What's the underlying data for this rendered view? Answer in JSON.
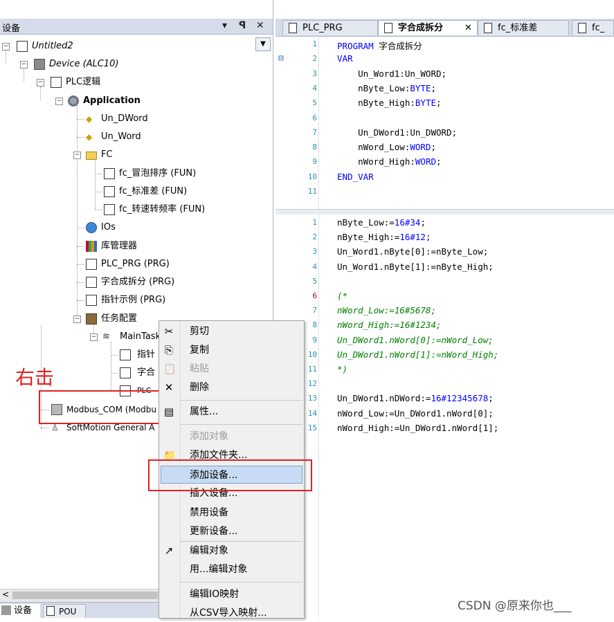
{
  "left_panel": {
    "title": "设备",
    "dropdown_btn": "▾",
    "pin_btn": "ꟼ",
    "close_btn": "✕",
    "combo_arrow": "▼",
    "tree": [
      {
        "label": "Untitled2"
      },
      {
        "label": "Device (ALC10)"
      },
      {
        "label": "PLC逻辑"
      },
      {
        "label": "Application"
      },
      {
        "label": "Un_DWord"
      },
      {
        "label": "Un_Word"
      },
      {
        "label": "FC"
      },
      {
        "label": "fc_冒泡排序 (FUN)"
      },
      {
        "label": "fc_标准差 (FUN)"
      },
      {
        "label": "fc_转速转频率 (FUN)"
      },
      {
        "label": "IOs"
      },
      {
        "label": "库管理器"
      },
      {
        "label": "PLC_PRG (PRG)"
      },
      {
        "label": "字合成拆分 (PRG)"
      },
      {
        "label": "指针示例 (PRG)"
      },
      {
        "label": "任务配置"
      },
      {
        "label": "MainTask"
      },
      {
        "label": "指针"
      },
      {
        "label": "字合"
      },
      {
        "label": "PLC"
      },
      {
        "label": "Modbus_COM (Modbu"
      },
      {
        "label": "SoftMotion General A"
      }
    ],
    "annotation": "右击",
    "bottom_tabs": [
      {
        "label": "设备"
      },
      {
        "label": "POU"
      }
    ],
    "scroll_left": "<"
  },
  "editor": {
    "tabs": [
      {
        "label": "PLC_PRG"
      },
      {
        "label": "字合成拆分",
        "close": "✕"
      },
      {
        "label": "fc_标准差"
      },
      {
        "label": "fc_冒"
      }
    ],
    "decl_lines": [
      {
        "n": "1",
        "text": "PROGRAM 字合成拆分"
      },
      {
        "n": "2",
        "text": "VAR"
      },
      {
        "n": "3",
        "text": "    Un_Word1:Un_WORD;"
      },
      {
        "n": "4",
        "text": "    nByte_Low:BYTE;"
      },
      {
        "n": "5",
        "text": "    nByte_High:BYTE;"
      },
      {
        "n": "6",
        "text": ""
      },
      {
        "n": "7",
        "text": "    Un_DWord1:Un_DWORD;"
      },
      {
        "n": "8",
        "text": "    nWord_Low:WORD;"
      },
      {
        "n": "9",
        "text": "    nWord_High:WORD;"
      },
      {
        "n": "10",
        "text": "END_VAR"
      },
      {
        "n": "11",
        "text": ""
      }
    ],
    "fold_marker": "⊟",
    "body_lines": [
      {
        "n": "1",
        "text": "nByte_Low:=16#34;"
      },
      {
        "n": "2",
        "text": "nByte_High:=16#12;"
      },
      {
        "n": "3",
        "text": "Un_Word1.nByte[0]:=nByte_Low;"
      },
      {
        "n": "4",
        "text": "Un_Word1.nByte[1]:=nByte_High;"
      },
      {
        "n": "5",
        "text": ""
      },
      {
        "n": "6",
        "text": "(*"
      },
      {
        "n": "7",
        "text": "nWord_Low:=16#5678;"
      },
      {
        "n": "8",
        "text": "nWord_High:=16#1234;"
      },
      {
        "n": "9",
        "text": "Un_DWord1.nWord[0]:=nWord_Low;"
      },
      {
        "n": "10",
        "text": "Un_DWord1.nWord[1]:=nWord_High;"
      },
      {
        "n": "11",
        "text": "*)"
      },
      {
        "n": "12",
        "text": ""
      },
      {
        "n": "13",
        "text": "Un_DWord1.nDWord:=16#12345678;"
      },
      {
        "n": "14",
        "text": "nWord_Low:=Un_DWord1.nWord[0];"
      },
      {
        "n": "15",
        "text": "nWord_High:=Un_DWord1.nWord[1];"
      }
    ]
  },
  "context_menu": {
    "items": [
      {
        "label": "剪切",
        "icon": "✂"
      },
      {
        "label": "复制",
        "icon": "⎘"
      },
      {
        "label": "粘贴",
        "icon": "📋",
        "disabled": true
      },
      {
        "label": "删除",
        "icon": "✕"
      },
      {
        "label": "属性...",
        "icon": "▤"
      },
      {
        "label": "添加对象",
        "disabled": true
      },
      {
        "label": "添加文件夹...",
        "icon": "📁"
      },
      {
        "label": "添加设备..."
      },
      {
        "label": "插入设备..."
      },
      {
        "label": "禁用设备"
      },
      {
        "label": "更新设备..."
      },
      {
        "label": "编辑对象",
        "icon": "↗"
      },
      {
        "label": "用...编辑对象"
      },
      {
        "label": "编辑IO映射"
      },
      {
        "label": "从CSV导入映射..."
      }
    ]
  },
  "watermark": "CSDN @原来你也___",
  "colors": {
    "highlight": "#c7dcf4",
    "annotation_red": "#e02020",
    "keyword": "#0000ff",
    "comment": "#008000",
    "line_number": "#2b91af"
  }
}
